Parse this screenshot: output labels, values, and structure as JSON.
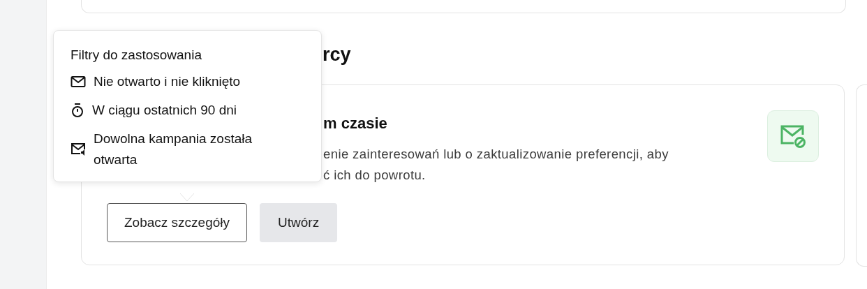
{
  "section_heading": "rcy",
  "card": {
    "title": "m czasie",
    "description_lines": [
      "enie zainteresowań lub o zaktualizowanie preferencji, aby",
      "ć ich do powrotu."
    ],
    "buttons": [
      {
        "label": "Zobacz szczegóły",
        "kind": "outline"
      },
      {
        "label": "Utwórz",
        "kind": "filled"
      }
    ]
  },
  "popover": {
    "title": "Filtry do zastosowania",
    "items": [
      {
        "label": "Nie otwarto i nie kliknięto",
        "kind": "envelope"
      },
      {
        "label": "W ciągu ostatnich 90 dni",
        "kind": "timer"
      },
      {
        "label": "Dowolna kampania została otwarta",
        "kind": "envelope-sound"
      }
    ]
  }
}
